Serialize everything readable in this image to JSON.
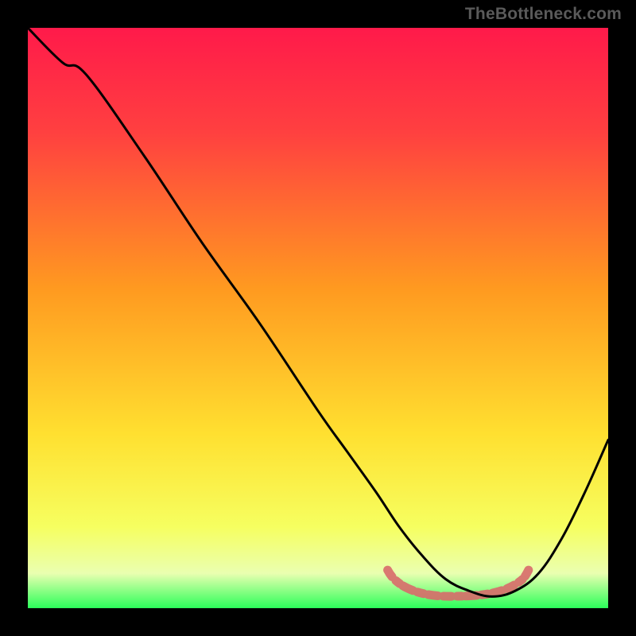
{
  "watermark": "TheBottleneck.com",
  "chart_data": {
    "type": "line",
    "title": "",
    "xlabel": "",
    "ylabel": "",
    "xlim": [
      0,
      100
    ],
    "ylim": [
      0,
      100
    ],
    "x": [
      0,
      6,
      10,
      20,
      30,
      40,
      50,
      55,
      60,
      64,
      68,
      72,
      76,
      80,
      84,
      88,
      92,
      96,
      100
    ],
    "values": [
      100,
      94,
      92,
      78,
      63,
      49,
      34,
      27,
      20,
      14,
      9,
      5,
      3,
      2,
      3,
      6,
      12,
      20,
      29
    ],
    "highlight_region": {
      "x_start": 62,
      "x_end": 86,
      "approx_y": 3
    },
    "gradient_stops": [
      {
        "offset": 0,
        "color": "#ff1a4a"
      },
      {
        "offset": 18,
        "color": "#ff4040"
      },
      {
        "offset": 45,
        "color": "#ff9a20"
      },
      {
        "offset": 70,
        "color": "#ffe030"
      },
      {
        "offset": 86,
        "color": "#f6ff60"
      },
      {
        "offset": 94,
        "color": "#eaffb0"
      },
      {
        "offset": 100,
        "color": "#2bff5a"
      }
    ],
    "curve_color": "#000000",
    "highlight_color": "#d86a6a"
  }
}
